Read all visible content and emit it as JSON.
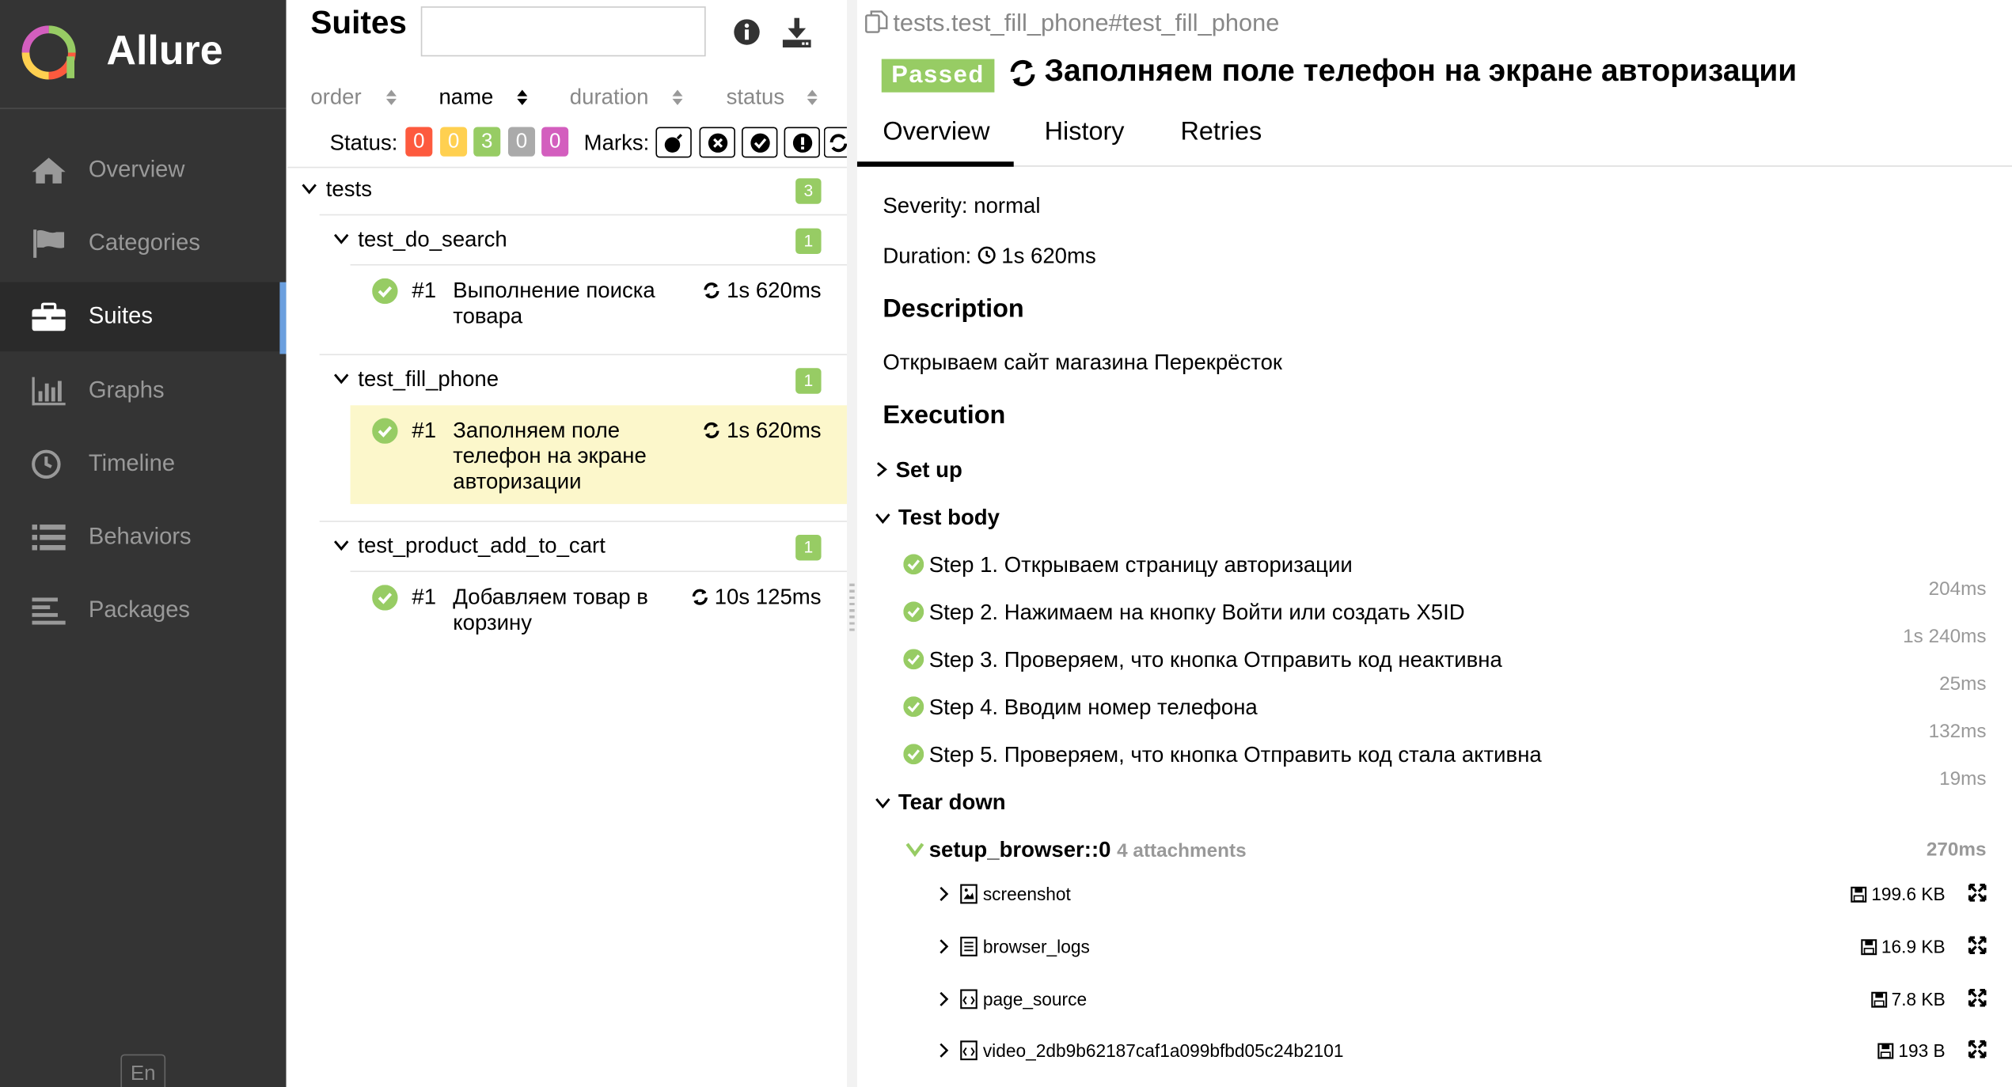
{
  "app": {
    "name": "Allure",
    "lang": "En"
  },
  "sidebar": {
    "items": [
      {
        "label": "Overview",
        "icon": "home-icon"
      },
      {
        "label": "Categories",
        "icon": "flag-icon"
      },
      {
        "label": "Suites",
        "icon": "briefcase-icon",
        "active": true
      },
      {
        "label": "Graphs",
        "icon": "bar-chart-icon"
      },
      {
        "label": "Timeline",
        "icon": "clock-icon"
      },
      {
        "label": "Behaviors",
        "icon": "list-icon"
      },
      {
        "label": "Packages",
        "icon": "align-left-icon"
      }
    ]
  },
  "suites": {
    "title": "Suites",
    "search_value": "",
    "sort": {
      "order": "order",
      "name": "name",
      "duration": "duration",
      "status": "status",
      "active": "name"
    },
    "status_label": "Status:",
    "status_counts": [
      {
        "value": "0",
        "color": "#fd5a3e"
      },
      {
        "value": "0",
        "color": "#ffd050"
      },
      {
        "value": "3",
        "color": "#97cc64"
      },
      {
        "value": "0",
        "color": "#aaaaaa"
      },
      {
        "value": "0",
        "color": "#d35ebe"
      }
    ],
    "marks_label": "Marks:",
    "tree": {
      "root": {
        "name": "tests",
        "count": "3"
      },
      "groups": [
        {
          "name": "test_do_search",
          "count": "1",
          "cases": [
            {
              "num": "#1",
              "title": "Выполнение поиска товара",
              "duration": "1s 620ms"
            }
          ]
        },
        {
          "name": "test_fill_phone",
          "count": "1",
          "cases": [
            {
              "num": "#1",
              "title": "Заполняем поле телефон на экране авторизации",
              "duration": "1s 620ms",
              "selected": true
            }
          ]
        },
        {
          "name": "test_product_add_to_cart",
          "count": "1",
          "cases": [
            {
              "num": "#1",
              "title": "Добавляем товар в корзину",
              "duration": "10s 125ms"
            }
          ]
        }
      ]
    }
  },
  "testcase": {
    "breadcrumb": "tests.test_fill_phone#test_fill_phone",
    "status": "Passed",
    "status_color": "#97cc64",
    "title": "Заполняем поле телефон на экране авторизации",
    "tabs": [
      "Overview",
      "History",
      "Retries"
    ],
    "severity": "Severity: normal",
    "duration_label": "Duration:",
    "duration": "1s 620ms",
    "description_heading": "Description",
    "description": "Открываем сайт магазина Перекрёсток",
    "execution_heading": "Execution",
    "setup_label": "Set up",
    "body_label": "Test body",
    "steps": [
      {
        "text": "Step 1. Открываем страницу авторизации",
        "duration": "204ms"
      },
      {
        "text": "Step 2. Нажимаем на кнопку Войти или создать X5ID",
        "duration": "1s 240ms"
      },
      {
        "text": "Step 3. Проверяем, что кнопка Отправить код неактивна",
        "duration": "25ms"
      },
      {
        "text": "Step 4. Вводим номер телефона",
        "duration": "132ms"
      },
      {
        "text": "Step 5. Проверяем, что кнопка Отправить код стала активна",
        "duration": "19ms"
      }
    ],
    "teardown_label": "Tear down",
    "fixture": {
      "name": "setup_browser::0",
      "attachments_label": "4 attachments",
      "duration": "270ms"
    },
    "attachments": [
      {
        "name": "screenshot",
        "size": "199.6 KB",
        "icon": "image-file-icon"
      },
      {
        "name": "browser_logs",
        "size": "16.9 KB",
        "icon": "text-file-icon"
      },
      {
        "name": "page_source",
        "size": "7.8 KB",
        "icon": "code-file-icon"
      },
      {
        "name": "video_2db9b62187caf1a099bfbd05c24b2101",
        "size": "193 B",
        "icon": "code-file-icon"
      }
    ]
  }
}
